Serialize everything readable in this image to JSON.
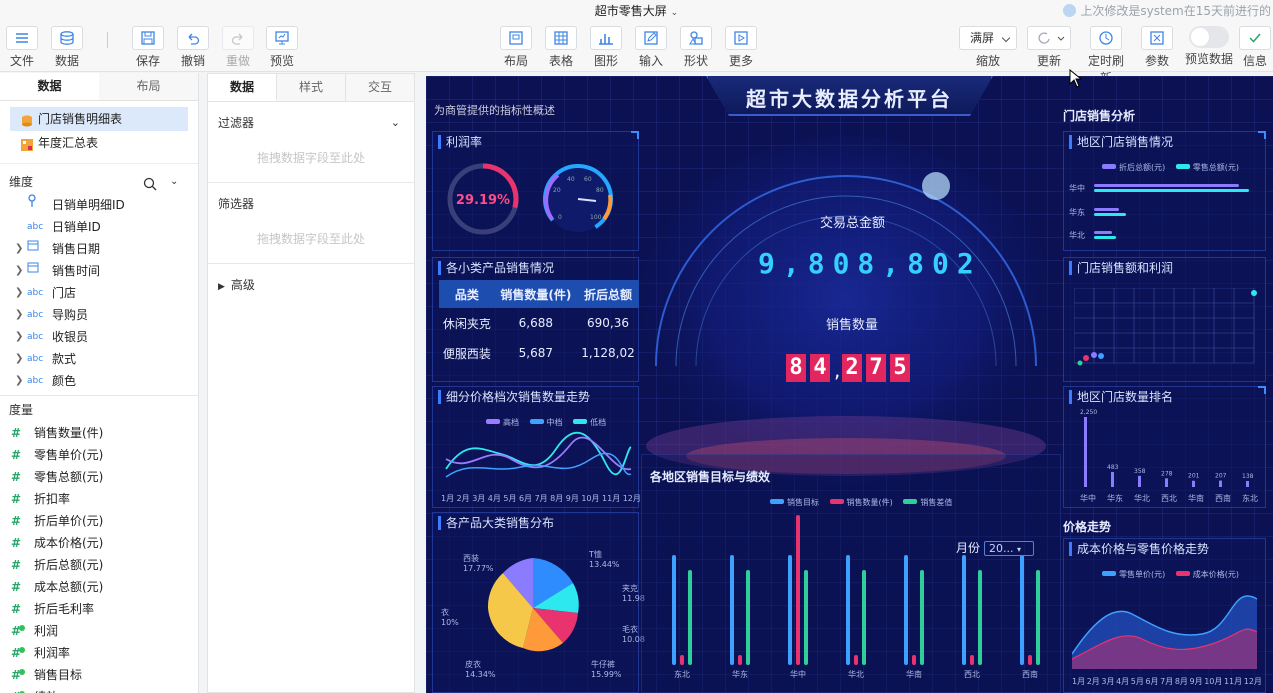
{
  "window": {
    "title": "超市零售大屏",
    "notice": "上次修改是system在15天前进行的"
  },
  "toolbar": {
    "file": "文件",
    "data": "数据",
    "save": "保存",
    "undo": "撤销",
    "redo": "重做",
    "preview": "预览",
    "layout": "布局",
    "table": "表格",
    "graphic": "图形",
    "input": "输入",
    "shape": "形状",
    "more": "更多",
    "zoom_value": "满屏",
    "zoom": "缩放",
    "refresh": "更新",
    "timed_refresh": "定时刷新",
    "params": "参数",
    "preview_data": "预览数据",
    "info": "信息"
  },
  "left_panel": {
    "tabs": [
      "数据",
      "布局"
    ],
    "datasets": [
      "门店销售明细表",
      "年度汇总表"
    ],
    "dimension_header": "维度",
    "dimensions": [
      {
        "label": "日销单明细ID",
        "icon": "key",
        "expandable": false
      },
      {
        "label": "日销单ID",
        "icon": "abc",
        "expandable": false
      },
      {
        "label": "销售日期",
        "icon": "calendar",
        "expandable": true
      },
      {
        "label": "销售时间",
        "icon": "calendar",
        "expandable": true
      },
      {
        "label": "门店",
        "icon": "abc",
        "expandable": true
      },
      {
        "label": "导购员",
        "icon": "abc",
        "expandable": true
      },
      {
        "label": "收银员",
        "icon": "abc",
        "expandable": true
      },
      {
        "label": "款式",
        "icon": "abc",
        "expandable": true
      },
      {
        "label": "颜色",
        "icon": "abc",
        "expandable": true
      }
    ],
    "measure_header": "度量",
    "measures": [
      {
        "label": "销售数量(件)",
        "calc": false
      },
      {
        "label": "零售单价(元)",
        "calc": false
      },
      {
        "label": "零售总额(元)",
        "calc": false
      },
      {
        "label": "折扣率",
        "calc": false
      },
      {
        "label": "折后单价(元)",
        "calc": false
      },
      {
        "label": "成本价格(元)",
        "calc": false
      },
      {
        "label": "折后总额(元)",
        "calc": false
      },
      {
        "label": "成本总额(元)",
        "calc": false
      },
      {
        "label": "折后毛利率",
        "calc": false
      },
      {
        "label": "利润",
        "calc": true
      },
      {
        "label": "利润率",
        "calc": true
      },
      {
        "label": "销售目标",
        "calc": true
      },
      {
        "label": "绩效",
        "calc": true
      }
    ]
  },
  "mid_panel": {
    "tabs": [
      "数据",
      "样式",
      "交互"
    ],
    "filter_label": "过滤器",
    "filter_placeholder": "拖拽数据字段至此处",
    "selector_label": "筛选器",
    "selector_placeholder": "拖拽数据字段至此处",
    "advanced_label": "高级"
  },
  "dashboard": {
    "title": "超市大数据分析平台",
    "left_top_caption": "为商管提供的指标性概述",
    "store_sales_title": "门店销售分析",
    "profit_rate_title": "利润率",
    "profit_rate_value": "29.19%",
    "profit_rate_fraction": 0.2919,
    "gauge_ticks": [
      "40",
      "60",
      "20",
      "80",
      "0",
      "100"
    ],
    "category_sales_title": "各小类产品销售情况",
    "category_table": {
      "headers": [
        "品类",
        "销售数量(件)",
        "折后总额"
      ],
      "rows": [
        [
          "休闲夹克",
          "6,688",
          "690,36"
        ],
        [
          "便服西装",
          "5,687",
          "1,128,02"
        ]
      ]
    },
    "total_amount_label": "交易总金额",
    "total_amount_value": "9,808,802",
    "sales_qty_label": "销售数量",
    "sales_qty_digits": [
      "8",
      "4",
      ",",
      "2",
      "7",
      "5"
    ],
    "price_trend_title": "细分价格档次销售数量走势",
    "price_trend_legend": [
      "高档",
      "中档",
      "低档"
    ],
    "months": [
      "1月",
      "2月",
      "3月",
      "4月",
      "5月",
      "6月",
      "7月",
      "8月",
      "9月",
      "10月",
      "11月",
      "12月"
    ],
    "region_target_title": "各地区销售目标与绩效",
    "month_label": "月份",
    "month_value": "20...",
    "region_target_legend": [
      "销售目标",
      "销售数量(件)",
      "销售差值"
    ],
    "region_target_x": [
      "东北",
      "华东",
      "华中",
      "华北",
      "华南",
      "西北",
      "西南"
    ],
    "category_dist_title": "各产品大类销售分布",
    "pie_labels": [
      {
        "name": "西装",
        "pct": "17.77%"
      },
      {
        "name": "T恤",
        "pct": "13.44%"
      },
      {
        "name": "夹克",
        "pct": "11.98"
      },
      {
        "name": "毛衣",
        "pct": "10.08"
      },
      {
        "name": "牛仔裤",
        "pct": "15.99%"
      },
      {
        "name": "皮衣",
        "pct": "14.34%"
      },
      {
        "name": "衣",
        "pct": "10%"
      }
    ],
    "region_store_sales_title": "地区门店销售情况",
    "region_store_sales_legend": [
      "折后总额(元)",
      "零售总额(元)"
    ],
    "region_store_sales_y": [
      "华中",
      "华东",
      "华北"
    ],
    "store_profit_title": "门店销售额和利润",
    "store_rank_title": "地区门店数量排名",
    "store_rank_values": [
      "2,250",
      "483",
      "358",
      "278",
      "201",
      "207",
      "138"
    ],
    "store_rank_x": [
      "华中",
      "华东",
      "华北",
      "西北",
      "华南",
      "西南",
      "东北"
    ],
    "price_trend2_header": "价格走势",
    "price_cost_title": "成本价格与零售价格走势",
    "price_cost_legend": [
      "零售单价(元)",
      "成本价格(元)"
    ]
  },
  "colors": {
    "accent": "#3e86e6",
    "canvas_bg": "#0b1152",
    "digit_bg": "#e2275f",
    "big_number": "#35d0ff"
  }
}
